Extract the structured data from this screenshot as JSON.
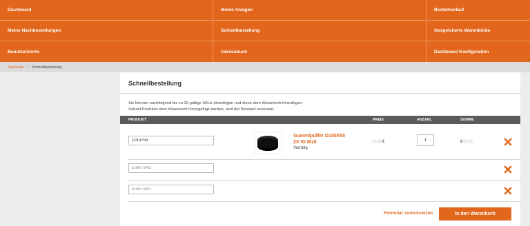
{
  "nav": {
    "row1": [
      "Dashboard",
      "Meine Anlagen",
      "Bestellverlauf"
    ],
    "row2": [
      "Meine Nachbestellungen",
      "Schnellbestellung",
      "Gespeicherte Warenkörbe"
    ],
    "row3": [
      "Benutzerkonto",
      "Adressbuch",
      "Dashboard Konfiguration"
    ]
  },
  "breadcrumb": {
    "home": "Startseite",
    "separator": "/",
    "current": "Schnellbestellung"
  },
  "panel": {
    "title": "Schnellbestellung",
    "desc_line1": "Sie können nachfolgend bis zu 25 gültige SKUs hinzufügen und diese dem Warenkorb hinzufügen.",
    "desc_line2": "Sobald Produkte dem Warenkorb hinzugefügt werden, wird der Bestand reserviert."
  },
  "table": {
    "headers": {
      "product": "PRODUKT",
      "price": "PREIS",
      "qty": "ANZAHL",
      "sum": "SUMME"
    },
    "rows": [
      {
        "sku": "1014793",
        "name": "Gummipuffer D150X55 2X IG M16",
        "stock": "Vorrätig",
        "price_blur": "41,85",
        "price_suffix": "€",
        "qty": "1",
        "sum_prefix": "€",
        "sum_blur": "41,85"
      },
      {
        "sku": "",
        "placeholder": "Enter SKU"
      },
      {
        "sku": "",
        "placeholder": "Enter SKU"
      }
    ]
  },
  "actions": {
    "reset": "Formular zurücksetzen",
    "add_to_cart": "In den Warenkorb"
  },
  "colors": {
    "accent": "#e2661b",
    "header_bar": "#5b5b5b",
    "background": "#ededed"
  },
  "icons": {
    "remove": "close-x-icon"
  }
}
